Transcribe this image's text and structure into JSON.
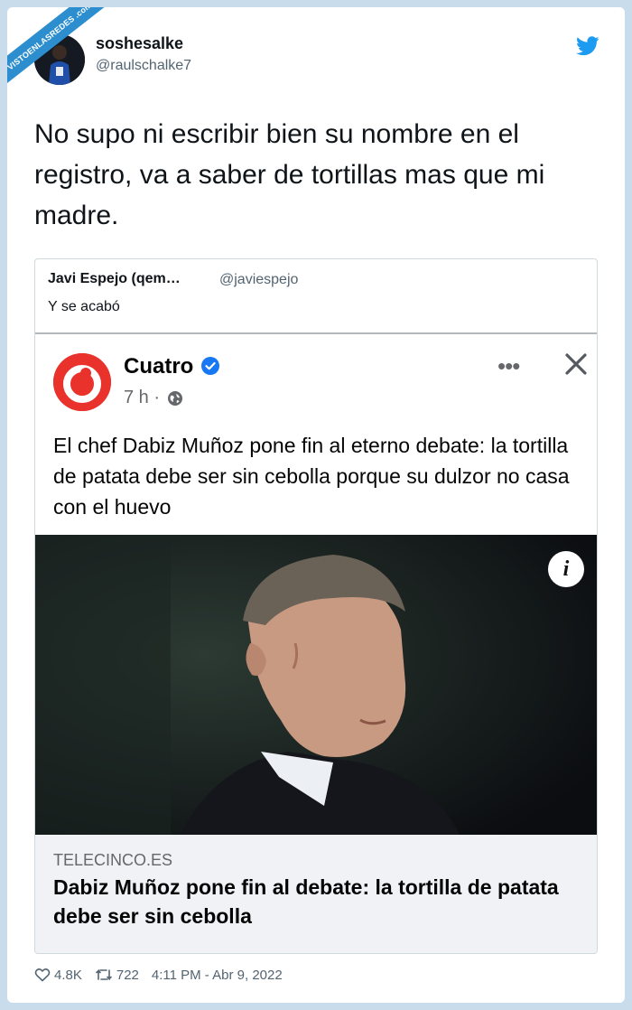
{
  "watermark": "VISTOENLASREDES .com",
  "tweet": {
    "display_name": "soshesalke",
    "handle": "@raulschalke7",
    "text": "No supo ni escribir bien su nombre en el registro, va a saber de tortillas mas que mi madre.",
    "likes": "4.8K",
    "retweets": "722",
    "timestamp": "4:11 PM - Abr 9, 2022"
  },
  "quoted_tweet": {
    "display_name": "Javi Espejo (qem…",
    "handle": "@javiespejo",
    "text": "Y se acabó"
  },
  "facebook_post": {
    "page_name": "Cuatro",
    "time": "7 h ·",
    "text": "El chef Dabiz Muñoz pone fin al eterno debate: la tortilla de patata debe ser sin cebolla porque su dulzor no casa con el huevo",
    "more_label": "•••",
    "info_label": "i",
    "link": {
      "domain": "TELECINCO.ES",
      "title": "Dabiz Muñoz pone fin al debate: la tortilla de patata debe ser sin cebolla"
    }
  },
  "colors": {
    "twitter_blue": "#1d9bf0",
    "cuatro_red": "#e8322b",
    "fb_verified_blue": "#1877f2"
  }
}
